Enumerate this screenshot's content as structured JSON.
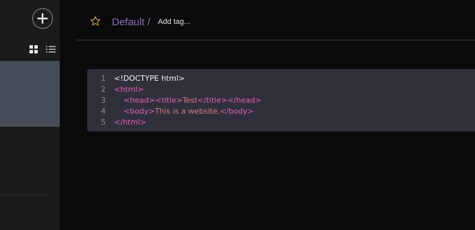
{
  "sidebar": {
    "add_button_icon": "plus-icon",
    "view_toggle": [
      "grid-view-icon",
      "list-view-icon"
    ]
  },
  "header": {
    "favorite_icon": "star-icon",
    "notebook": "Default /",
    "add_tag": "Add tag..."
  },
  "editor": {
    "lines": [
      {
        "number": "1",
        "tokens": [
          {
            "t": "<!DOCTYPE html>",
            "c": "plain"
          }
        ]
      },
      {
        "number": "2",
        "tokens": [
          {
            "t": "<html>",
            "c": "tag"
          }
        ]
      },
      {
        "number": "3",
        "tokens": [
          {
            "t": "    ",
            "c": "plain"
          },
          {
            "t": "<head>",
            "c": "tag"
          },
          {
            "t": "<title>",
            "c": "tag"
          },
          {
            "t": "Test",
            "c": "str"
          },
          {
            "t": "</title>",
            "c": "tag"
          },
          {
            "t": "</head>",
            "c": "tag"
          }
        ]
      },
      {
        "number": "4",
        "tokens": [
          {
            "t": "    ",
            "c": "plain"
          },
          {
            "t": "<body>",
            "c": "tag"
          },
          {
            "t": "This is a website.",
            "c": "str"
          },
          {
            "t": "</body>",
            "c": "tag"
          }
        ]
      },
      {
        "number": "5",
        "tokens": [
          {
            "t": "</html>",
            "c": "tag"
          }
        ]
      }
    ]
  },
  "colors": {
    "accent_purple": "#8b6fb3",
    "tag_pink": "#e65fb1",
    "string_rose": "#d47d85",
    "selection_bg": "#474c59"
  }
}
